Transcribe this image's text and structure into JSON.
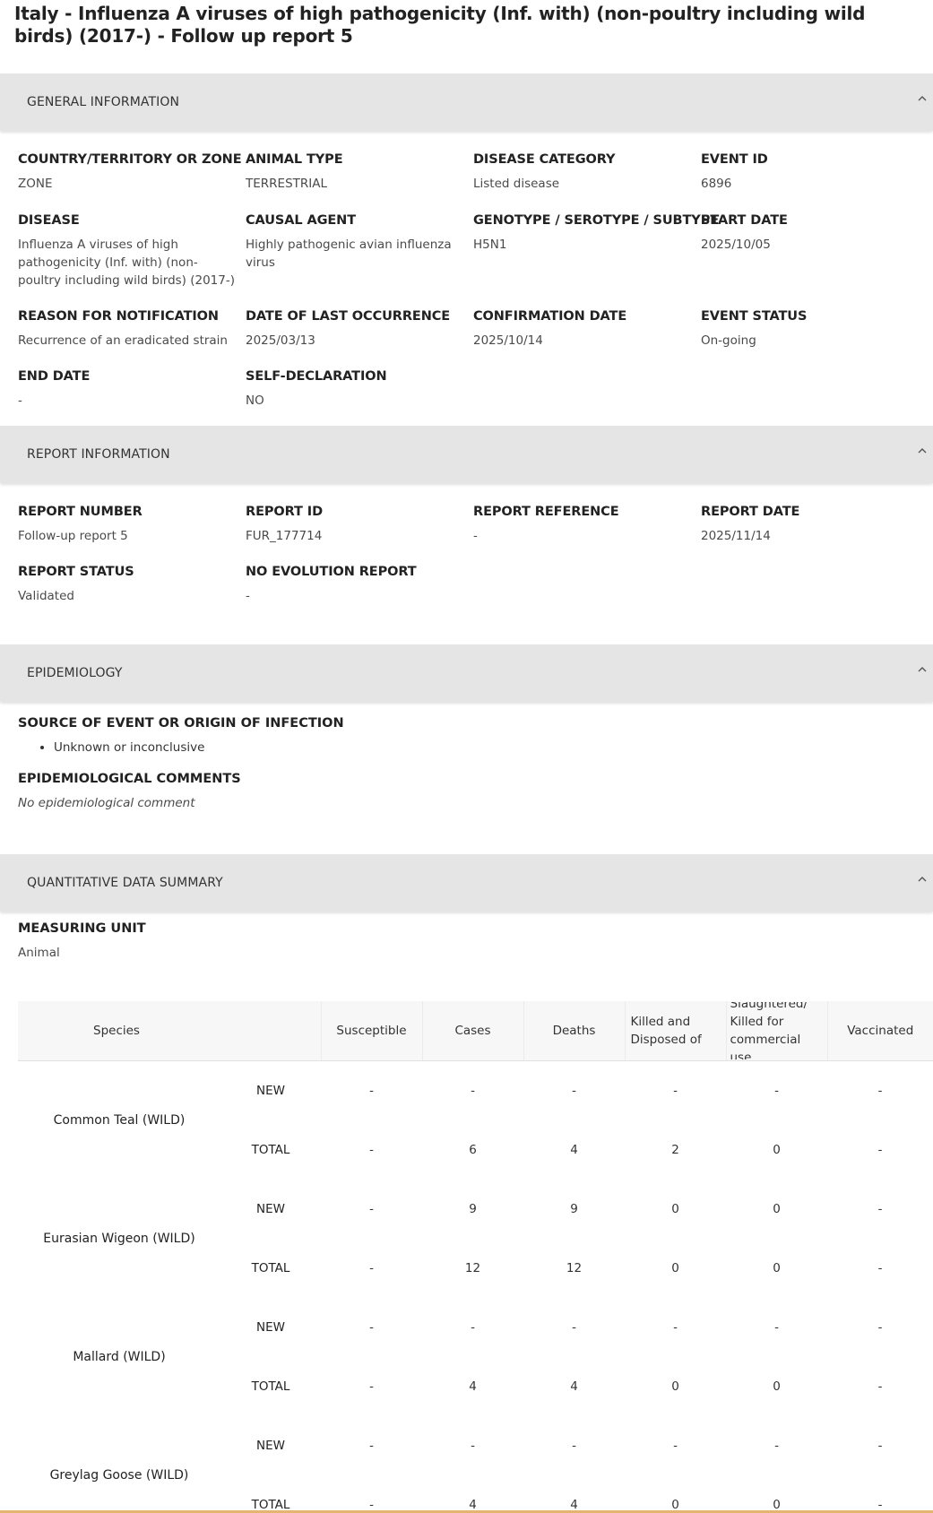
{
  "page": {
    "title": "Italy - Influenza A viruses of high pathogenicity (Inf. with) (non-poultry including wild birds) (2017-) - Follow up report 5"
  },
  "general": {
    "header": "GENERAL INFORMATION",
    "fields": [
      {
        "label": "COUNTRY/TERRITORY OR ZONE",
        "value": "ZONE"
      },
      {
        "label": "ANIMAL TYPE",
        "value": "TERRESTRIAL"
      },
      {
        "label": "DISEASE CATEGORY",
        "value": "Listed disease"
      },
      {
        "label": "EVENT ID",
        "value": "6896"
      },
      {
        "label": "DISEASE",
        "value": "Influenza A viruses of high pathogenicity (Inf. with) (non-poultry including wild birds) (2017-)"
      },
      {
        "label": "CAUSAL AGENT",
        "value": "Highly pathogenic avian influenza virus"
      },
      {
        "label": "GENOTYPE / SEROTYPE / SUBTYPE",
        "value": "H5N1"
      },
      {
        "label": "START DATE",
        "value": "2025/10/05"
      },
      {
        "label": "REASON FOR NOTIFICATION",
        "value": "Recurrence of an eradicated strain"
      },
      {
        "label": "DATE OF LAST OCCURRENCE",
        "value": "2025/03/13"
      },
      {
        "label": "CONFIRMATION DATE",
        "value": "2025/10/14"
      },
      {
        "label": "EVENT STATUS",
        "value": "On-going"
      },
      {
        "label": "END DATE",
        "value": "-"
      },
      {
        "label": "SELF-DECLARATION",
        "value": "NO"
      }
    ]
  },
  "report": {
    "header": "REPORT INFORMATION",
    "fields": [
      {
        "label": "REPORT NUMBER",
        "value": "Follow-up report 5"
      },
      {
        "label": "REPORT ID",
        "value": "FUR_177714"
      },
      {
        "label": "REPORT REFERENCE",
        "value": "-"
      },
      {
        "label": "REPORT DATE",
        "value": "2025/11/14"
      },
      {
        "label": "REPORT STATUS",
        "value": "Validated"
      },
      {
        "label": "NO EVOLUTION REPORT",
        "value": "-"
      }
    ]
  },
  "epidemiology": {
    "header": "EPIDEMIOLOGY",
    "source_label": "SOURCE OF EVENT OR ORIGIN OF INFECTION",
    "source_items": [
      "Unknown or inconclusive"
    ],
    "comments_label": "EPIDEMIOLOGICAL COMMENTS",
    "comments_value": "No epidemiological comment"
  },
  "quantitative": {
    "header": "QUANTITATIVE DATA SUMMARY",
    "unit_label": "MEASURING UNIT",
    "unit_value": "Animal",
    "columns": {
      "species": "Species",
      "susceptible": "Susceptible",
      "cases": "Cases",
      "deaths": "Deaths",
      "killed": "Killed and Disposed of",
      "slaughtered": "Slaughtered/ Killed for commercial use",
      "vaccinated": "Vaccinated"
    },
    "rows": [
      {
        "species": "Common Teal (WILD)",
        "new": {
          "label": "NEW",
          "susceptible": "-",
          "cases": "-",
          "deaths": "-",
          "killed": "-",
          "slaughtered": "-",
          "vaccinated": "-"
        },
        "total": {
          "label": "TOTAL",
          "susceptible": "-",
          "cases": "6",
          "deaths": "4",
          "killed": "2",
          "slaughtered": "0",
          "vaccinated": "-"
        }
      },
      {
        "species": "Eurasian Wigeon (WILD)",
        "new": {
          "label": "NEW",
          "susceptible": "-",
          "cases": "9",
          "deaths": "9",
          "killed": "0",
          "slaughtered": "0",
          "vaccinated": "-"
        },
        "total": {
          "label": "TOTAL",
          "susceptible": "-",
          "cases": "12",
          "deaths": "12",
          "killed": "0",
          "slaughtered": "0",
          "vaccinated": "-"
        }
      },
      {
        "species": "Mallard (WILD)",
        "new": {
          "label": "NEW",
          "susceptible": "-",
          "cases": "-",
          "deaths": "-",
          "killed": "-",
          "slaughtered": "-",
          "vaccinated": "-"
        },
        "total": {
          "label": "TOTAL",
          "susceptible": "-",
          "cases": "4",
          "deaths": "4",
          "killed": "0",
          "slaughtered": "0",
          "vaccinated": "-"
        }
      },
      {
        "species": "Greylag Goose (WILD)",
        "new": {
          "label": "NEW",
          "susceptible": "-",
          "cases": "-",
          "deaths": "-",
          "killed": "-",
          "slaughtered": "-",
          "vaccinated": "-"
        },
        "total": {
          "label": "TOTAL",
          "susceptible": "-",
          "cases": "4",
          "deaths": "4",
          "killed": "0",
          "slaughtered": "0",
          "vaccinated": "-"
        }
      }
    ]
  }
}
